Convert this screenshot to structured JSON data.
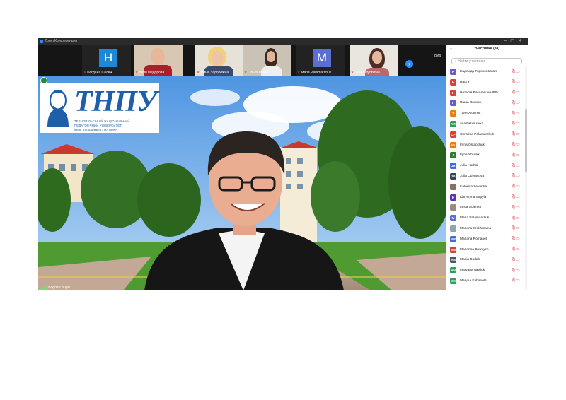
{
  "window": {
    "title": "Zoom Конференция"
  },
  "strip": {
    "participants": [
      {
        "name": "Богдана Салюк",
        "avatar_letter": "H",
        "avatar_color": "#1e88d6",
        "kind": "avatar"
      },
      {
        "name": "Юлія Федорова",
        "kind": "video"
      },
      {
        "name": "Ірина Задорожна",
        "kind": "video"
      },
      {
        "name": "Ольга Лацка",
        "kind": "video"
      },
      {
        "name": "Maria Palamarchuk",
        "avatar_letter": "M",
        "avatar_color": "#5b6fd1",
        "kind": "avatar"
      },
      {
        "name": "Julia Odyntsova",
        "kind": "video"
      }
    ],
    "next_label": "›",
    "view_label": "Вид"
  },
  "main": {
    "speaker_name": "Bogdan Bujak",
    "logo": {
      "big": "ТНПУ",
      "lines": [
        "ТЕРНОПІЛЬСЬКИЙ НАЦІОНАЛЬНИЙ",
        "ПЕДАГОГІЧНИЙ УНІВЕРСИТЕТ",
        "імені Володимира ГНАТЮКА"
      ]
    }
  },
  "panel": {
    "title": "Участники (88)",
    "collapse_icon": "chevron-down-icon",
    "search_placeholder": "Найти участника",
    "participants": [
      {
        "initials": "Н",
        "name": "Надежда Горохоовская",
        "color": "#6a5acd"
      },
      {
        "initials": "Н",
        "name": "Настя",
        "color": "#d84339"
      },
      {
        "initials": "Н",
        "name": "Наталія Василишин-ФЛ-1",
        "color": "#d84339"
      },
      {
        "initials": "П",
        "name": "Паша Волков",
        "color": "#6a5acd"
      },
      {
        "initials": "Т",
        "name": "Таня Жовтюк",
        "color": "#ef7d00"
      },
      {
        "initials": "AR",
        "name": "anastasiia reiko",
        "color": "#2e9e5b"
      },
      {
        "initials": "CP",
        "name": "Christina Palamarchuk",
        "color": "#d84339"
      },
      {
        "initials": "IO",
        "name": "Iryna Ostapchuk",
        "color": "#ef7d00"
      },
      {
        "initials": "I",
        "name": "Iryna Shuliak",
        "color": "#2e7d32"
      },
      {
        "initials": "JH",
        "name": "Julia Harhai",
        "color": "#3a6fd8"
      },
      {
        "initials": "JO",
        "name": "Julia Odyntsova",
        "color": "#37474f"
      },
      {
        "initials": "",
        "name": "Katerina Severina",
        "color": "#8d6e63"
      },
      {
        "initials": "K",
        "name": "Khrystyna Sapyla",
        "color": "#5e35b1"
      },
      {
        "initials": "",
        "name": "Lesia Solenko",
        "color": "#a1887f"
      },
      {
        "initials": "M",
        "name": "Maria Palamarchuk",
        "color": "#5b6fd1"
      },
      {
        "initials": "",
        "name": "Mariana Krokhmalna",
        "color": "#90a4ae"
      },
      {
        "initials": "MR",
        "name": "Mariana Romaneti",
        "color": "#3a6fd8"
      },
      {
        "initials": "MB",
        "name": "Marianna Bawvych",
        "color": "#d84339"
      },
      {
        "initials": "MB",
        "name": "Mariia Bodak",
        "color": "#455a64"
      },
      {
        "initials": "MN",
        "name": "maryana natsiuk",
        "color": "#2e9e5b"
      },
      {
        "initials": "MK",
        "name": "Maryna Kabanets",
        "color": "#2e9e5b"
      }
    ]
  },
  "colors": {
    "zoom_blue": "#2d8cff",
    "muted_red": "#d8242e",
    "logo_blue": "#1d5fa8"
  }
}
